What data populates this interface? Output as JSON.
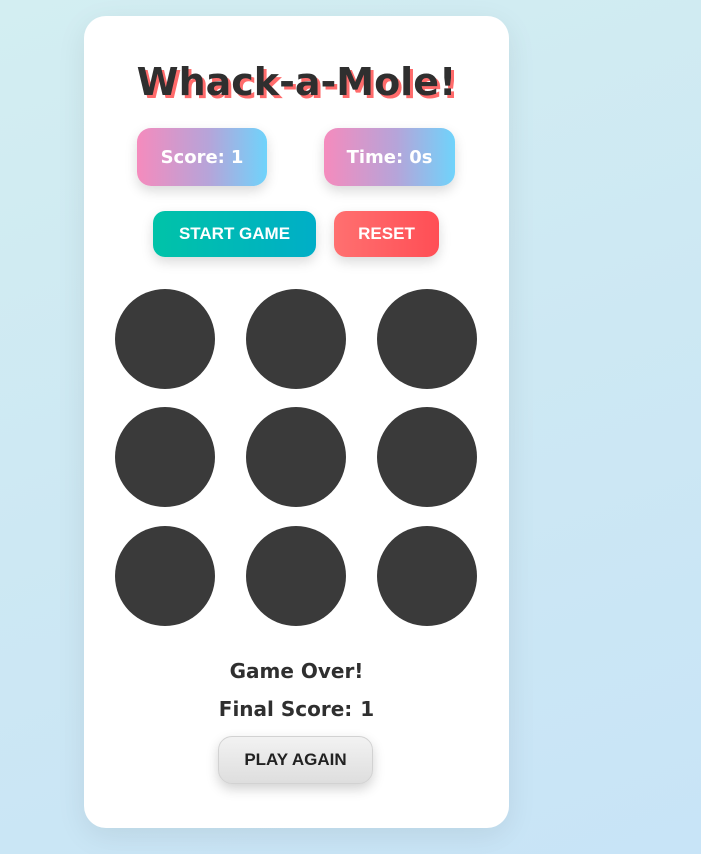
{
  "game": {
    "title": "Whack-a-Mole!",
    "score_label": "Score:",
    "score_value": "1",
    "time_label": "Time:",
    "time_value": "0s"
  },
  "controls": {
    "start_label": "START GAME",
    "reset_label": "RESET"
  },
  "board": {
    "holes": 9,
    "hole_color": "#3a3a3a"
  },
  "result": {
    "message": "Game Over!",
    "final_label": "Final Score:",
    "final_value": "1",
    "play_again_label": "PLAY AGAIN"
  },
  "colors": {
    "accent_title_shadow": "#ff6b6b",
    "start_gradient": [
      "#00c3a8",
      "#00aec7"
    ],
    "reset_gradient": [
      "#ff7070",
      "#ff4e55"
    ],
    "stat_gradient": [
      "#f58bbd",
      "#6fd3fb"
    ]
  }
}
